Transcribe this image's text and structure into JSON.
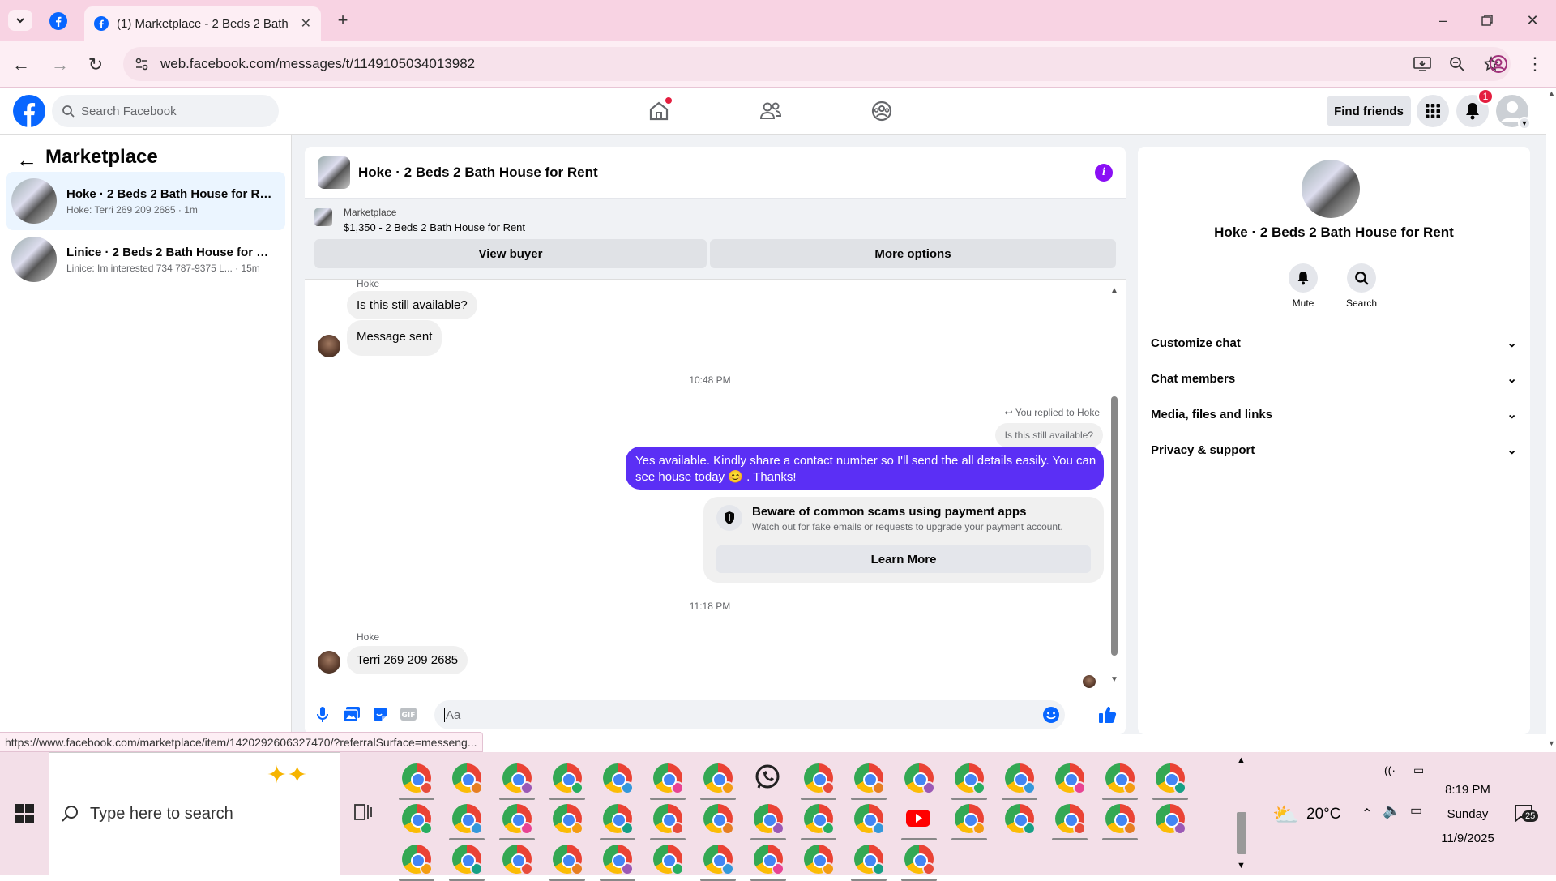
{
  "browser": {
    "tab_title": "(1) Marketplace - 2 Beds 2 Bath",
    "url": "web.facebook.com/messages/t/1149105034013982",
    "status_link": "https://www.facebook.com/marketplace/item/1420292606327470/?referralSurface=messeng..."
  },
  "header": {
    "search_placeholder": "Search Facebook",
    "find_friends": "Find friends",
    "notification_count": "1"
  },
  "sidebar": {
    "title": "Marketplace",
    "conversations": [
      {
        "title": "Hoke · 2 Beds 2 Bath House for Rent",
        "snippet": "Hoke: Terri 269 209 2685 · 1m"
      },
      {
        "title": "Linice · 2 Beds 2 Bath House for Re...",
        "snippet": "Linice: Im interested 734 787-9375 L... · 15m"
      }
    ]
  },
  "chat": {
    "title": "Hoke · 2 Beds 2 Bath House for Rent",
    "listing_label": "Marketplace",
    "listing_detail": "$1,350 - 2 Beds 2 Bath House for Rent",
    "view_buyer": "View buyer",
    "more_options": "More options",
    "messages": {
      "sender1": "Hoke",
      "m1": "Is this still available?",
      "m2": "Message sent",
      "time1": "10:48 PM",
      "replied_to": "You replied to Hoke",
      "quoted": "Is this still available?",
      "reply_line1": "Yes available. Kindly share a contact number so I'll send the all details easily. You can",
      "reply_line2": "see house today 😊 . Thanks!",
      "scam_title": "Beware of common scams using payment apps",
      "scam_text": "Watch out for fake emails or requests to upgrade your payment account.",
      "learn_more": "Learn More",
      "time2": "11:18 PM",
      "sender2": "Hoke",
      "m3": "Terri 269 209 2685"
    },
    "composer_placeholder": "Aa"
  },
  "details": {
    "title": "Hoke · 2 Beds 2 Bath House for Rent",
    "mute": "Mute",
    "search": "Search",
    "sections": [
      "Customize chat",
      "Chat members",
      "Media, files and links",
      "Privacy & support"
    ]
  },
  "taskbar": {
    "search_placeholder": "Type here to search",
    "weather": "20°C",
    "time": "8:19 PM",
    "day": "Sunday",
    "date": "11/9/2025",
    "notif_count": "25"
  },
  "colors": {
    "fb_blue": "#0866ff",
    "outgoing": "#5b2ff5",
    "tab_bg": "#f8d3e3"
  }
}
